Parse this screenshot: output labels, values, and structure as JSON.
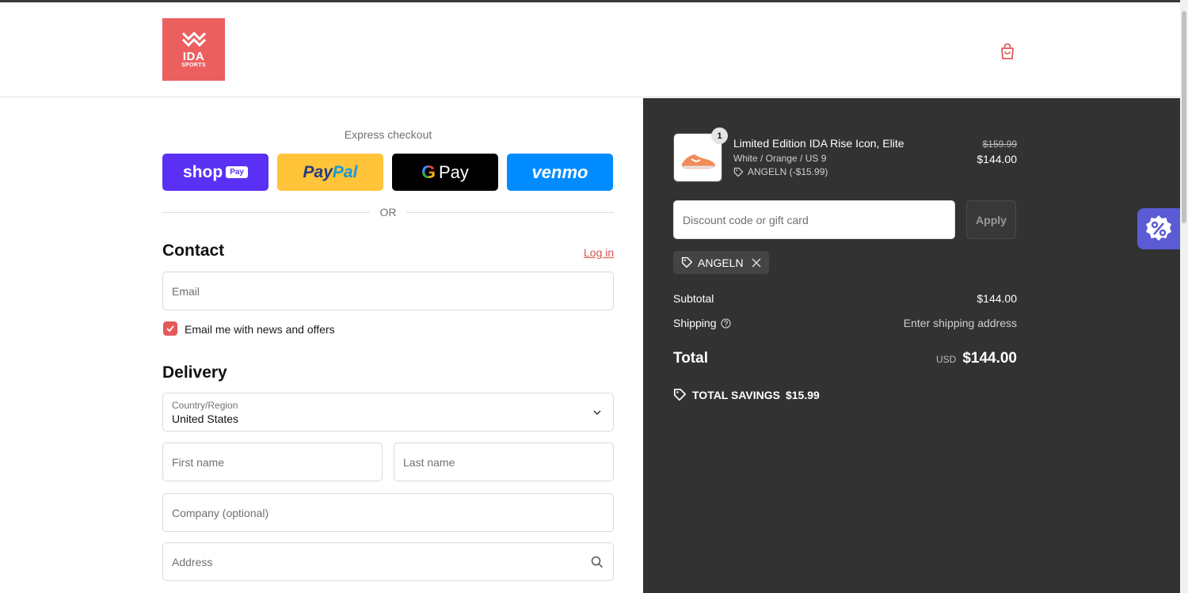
{
  "brand": {
    "logo_line1": "IDA",
    "logo_line2": "SPORTS",
    "logo_color": "#ec5f5f"
  },
  "header": {
    "cart_icon": "shopping-bag-icon"
  },
  "express": {
    "title": "Express checkout",
    "shop_pay": {
      "text": "shop",
      "badge": "Pay"
    },
    "paypal": {
      "part1": "Pay",
      "part2": "Pal"
    },
    "google_pay": {
      "g": "G",
      "text": "Pay"
    },
    "venmo": "venmo",
    "divider": "OR"
  },
  "contact": {
    "heading": "Contact",
    "login": "Log in",
    "email_placeholder": "Email",
    "newsletter_label": "Email me with news and offers",
    "newsletter_checked": true
  },
  "delivery": {
    "heading": "Delivery",
    "country_label": "Country/Region",
    "country_value": "United States",
    "first_name_placeholder": "First name",
    "last_name_placeholder": "Last name",
    "company_placeholder": "Company (optional)",
    "address_placeholder": "Address"
  },
  "order": {
    "item": {
      "quantity": "1",
      "name": "Limited Edition IDA Rise Icon, Elite",
      "variant": "White / Orange / US 9",
      "discount": "ANGELN (-$15.99)",
      "original_price": "$159.99",
      "price": "$144.00"
    },
    "discount_placeholder": "Discount code or gift card",
    "apply_label": "Apply",
    "applied_code": "ANGELN",
    "subtotal_label": "Subtotal",
    "subtotal_value": "$144.00",
    "shipping_label": "Shipping",
    "shipping_value": "Enter shipping address",
    "total_label": "Total",
    "total_currency": "USD",
    "total_value": "$144.00",
    "savings_label": "TOTAL SAVINGS",
    "savings_value": "$15.99"
  },
  "colors": {
    "accent": "#e45b5b",
    "panel": "#323232",
    "promo": "#5b5bd6"
  }
}
